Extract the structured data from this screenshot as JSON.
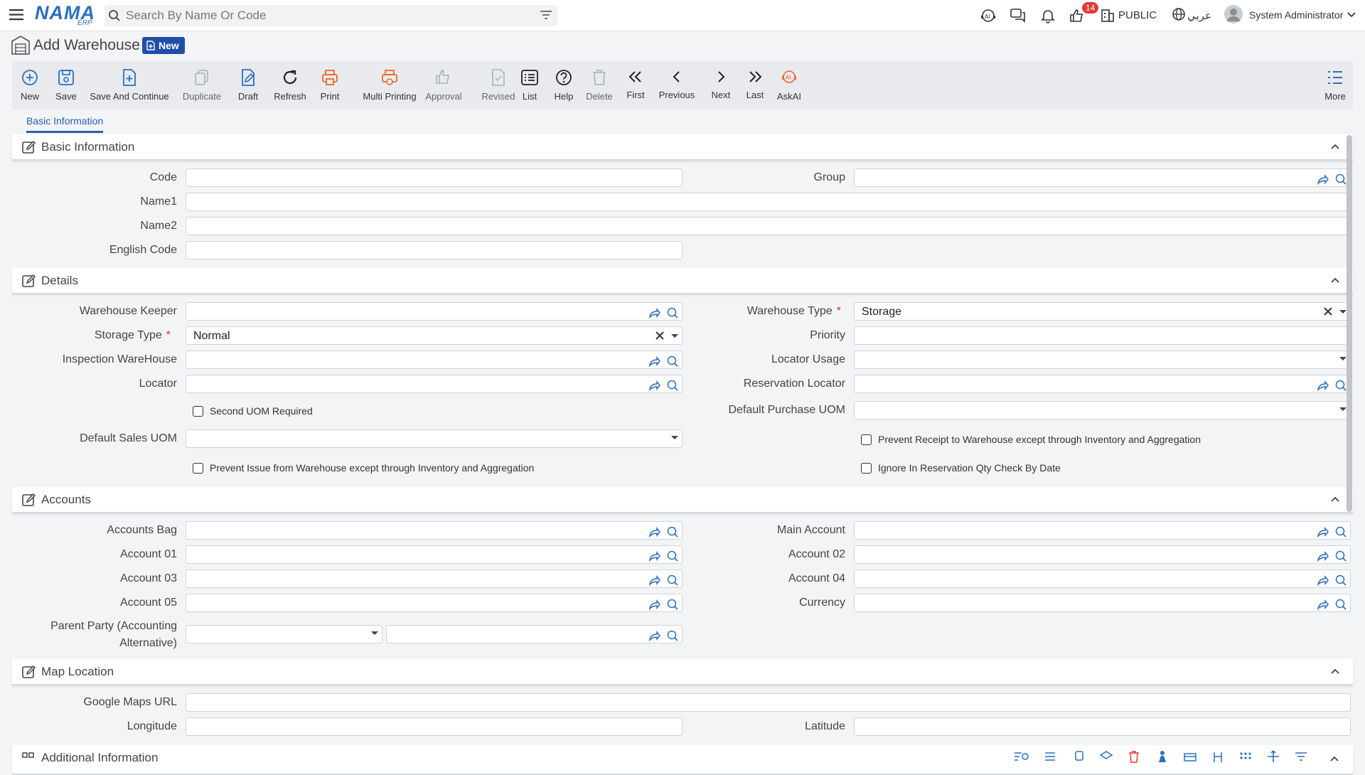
{
  "app": {
    "logo_text": "NAMA",
    "logo_sub": "ERP"
  },
  "topbar": {
    "search_placeholder": "Search By Name Or Code",
    "notification_count": "14",
    "public_label": "PUBLIC",
    "language_label": "عربي",
    "user_name": "System Administrator"
  },
  "page": {
    "title": "Add Warehouse",
    "badge": "New"
  },
  "toolbar": {
    "new": "New",
    "save": "Save",
    "save_continue": "Save And Continue",
    "duplicate": "Duplicate",
    "draft": "Draft",
    "refresh": "Refresh",
    "print": "Print",
    "multi_printing": "Multi Printing",
    "approval": "Approval",
    "revised": "Revised",
    "list": "List",
    "help": "Help",
    "delete": "Delete",
    "first": "First",
    "previous": "Previous",
    "next": "Next",
    "last": "Last",
    "askai": "AskAI",
    "more": "More"
  },
  "tabs": {
    "basic": "Basic Information"
  },
  "sections": {
    "basic": {
      "title": "Basic Information",
      "code": "Code",
      "group": "Group",
      "name1": "Name1",
      "name2": "Name2",
      "english_code": "English Code"
    },
    "details": {
      "title": "Details",
      "warehouse_keeper": "Warehouse Keeper",
      "warehouse_type": "Warehouse Type",
      "warehouse_type_value": "Storage",
      "storage_type": "Storage Type",
      "storage_type_value": "Normal",
      "priority": "Priority",
      "inspection_warehouse": "Inspection WareHouse",
      "locator_usage": "Locator Usage",
      "locator": "Locator",
      "reservation_locator": "Reservation Locator",
      "second_uom_required": "Second UOM Required",
      "default_purchase_uom": "Default Purchase UOM",
      "default_sales_uom": "Default Sales UOM",
      "prevent_receipt": "Prevent Receipt to Warehouse except through Inventory and Aggregation",
      "prevent_issue": "Prevent Issue from Warehouse except through Inventory and Aggregation",
      "ignore_reservation": "Ignore In Reservation Qty Check By Date"
    },
    "accounts": {
      "title": "Accounts",
      "accounts_bag": "Accounts Bag",
      "main_account": "Main Account",
      "account_01": "Account 01",
      "account_02": "Account 02",
      "account_03": "Account 03",
      "account_04": "Account 04",
      "account_05": "Account 05",
      "currency": "Currency",
      "parent_party_line1": "Parent Party (Accounting",
      "parent_party_line2": "Alternative)"
    },
    "map": {
      "title": "Map Location",
      "google_maps_url": "Google Maps URL",
      "longitude": "Longitude",
      "latitude": "Latitude"
    },
    "additional": {
      "title": "Additional Information"
    }
  },
  "colors": {
    "accent": "#2a6fbf",
    "print_orange": "#e86a2a",
    "badge_navy": "#1f4fa8",
    "required": "#d32f2f"
  }
}
